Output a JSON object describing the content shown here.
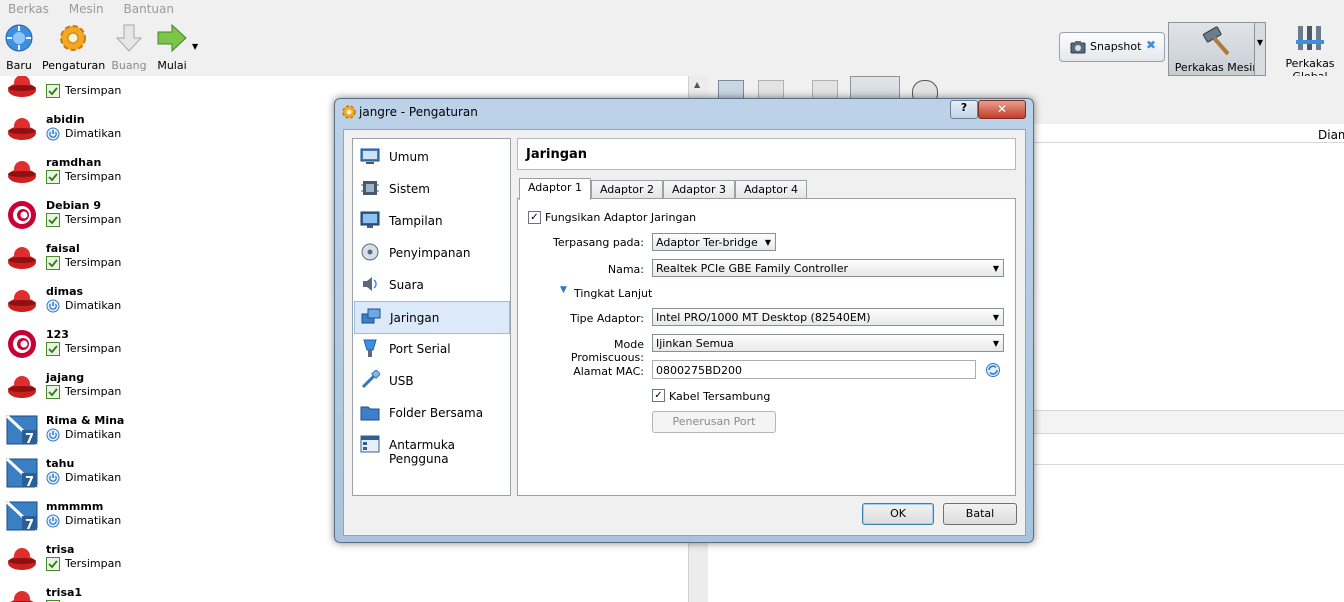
{
  "menubar": {
    "items": [
      "Berkas",
      "Mesin",
      "Bantuan"
    ]
  },
  "toolbar": {
    "baru": "Baru",
    "pengaturan": "Pengaturan",
    "buang": "Buang",
    "mulai": "Mulai",
    "snapshot": "Snapshot",
    "perkakas_mesin": "Perkakas Mesin",
    "perkakas_global": "Perkakas Global"
  },
  "vm_list": [
    {
      "name": "",
      "state": "Tersimpan",
      "os": "redhat"
    },
    {
      "name": "abidin",
      "state": "Dimatikan",
      "os": "redhat"
    },
    {
      "name": "ramdhan",
      "state": "Tersimpan",
      "os": "redhat"
    },
    {
      "name": "Debian 9",
      "state": "Tersimpan",
      "os": "debian"
    },
    {
      "name": "faisal",
      "state": "Tersimpan",
      "os": "redhat"
    },
    {
      "name": "dimas",
      "state": "Dimatikan",
      "os": "redhat"
    },
    {
      "name": "123",
      "state": "Tersimpan",
      "os": "debian"
    },
    {
      "name": "jajang",
      "state": "Tersimpan",
      "os": "redhat"
    },
    {
      "name": "Rima & Mina",
      "state": "Dimatikan",
      "os": "win7"
    },
    {
      "name": "tahu",
      "state": "Dimatikan",
      "os": "win7"
    },
    {
      "name": "mmmmm",
      "state": "Dimatikan",
      "os": "win7"
    },
    {
      "name": "trisa",
      "state": "Tersimpan",
      "os": "redhat"
    },
    {
      "name": "trisa1",
      "state": "Tersimpan",
      "os": "redhat"
    }
  ],
  "right_pane": {
    "column_header": "Diam"
  },
  "dialog": {
    "title": "jangre - Pengaturan",
    "help": "?",
    "close": "✕",
    "nav": [
      {
        "label": "Umum",
        "icon": "general-icon"
      },
      {
        "label": "Sistem",
        "icon": "system-icon"
      },
      {
        "label": "Tampilan",
        "icon": "display-icon"
      },
      {
        "label": "Penyimpanan",
        "icon": "storage-icon"
      },
      {
        "label": "Suara",
        "icon": "audio-icon"
      },
      {
        "label": "Jaringan",
        "icon": "network-icon"
      },
      {
        "label": "Port Serial",
        "icon": "serial-port-icon"
      },
      {
        "label": "USB",
        "icon": "usb-icon"
      },
      {
        "label": "Folder Bersama",
        "icon": "shared-folder-icon"
      },
      {
        "label": "Antarmuka Pengguna",
        "icon": "user-interface-icon"
      }
    ],
    "selected_nav": "Jaringan",
    "section_title": "Jaringan",
    "tabs": [
      "Adaptor 1",
      "Adaptor 2",
      "Adaptor 3",
      "Adaptor 4"
    ],
    "active_tab": "Adaptor 1",
    "enable_adapter": {
      "label": "Fungsikan Adaptor Jaringan",
      "checked": true
    },
    "attached_to": {
      "label": "Terpasang pada:",
      "value": "Adaptor Ter-bridge"
    },
    "name": {
      "label": "Nama:",
      "value": "Realtek PCIe GBE Family Controller"
    },
    "advanced": "Tingkat Lanjut",
    "adapter_type": {
      "label": "Tipe Adaptor:",
      "value": "Intel PRO/1000 MT Desktop (82540EM)"
    },
    "promiscuous": {
      "label": "Mode Promiscuous:",
      "value": "Ijinkan Semua"
    },
    "mac": {
      "label": "Alamat MAC:",
      "value": "0800275BD200"
    },
    "cable_connected": {
      "label": "Kabel Tersambung",
      "checked": true
    },
    "port_forwarding": "Penerusan Port",
    "ok": "OK",
    "cancel": "Batal"
  }
}
